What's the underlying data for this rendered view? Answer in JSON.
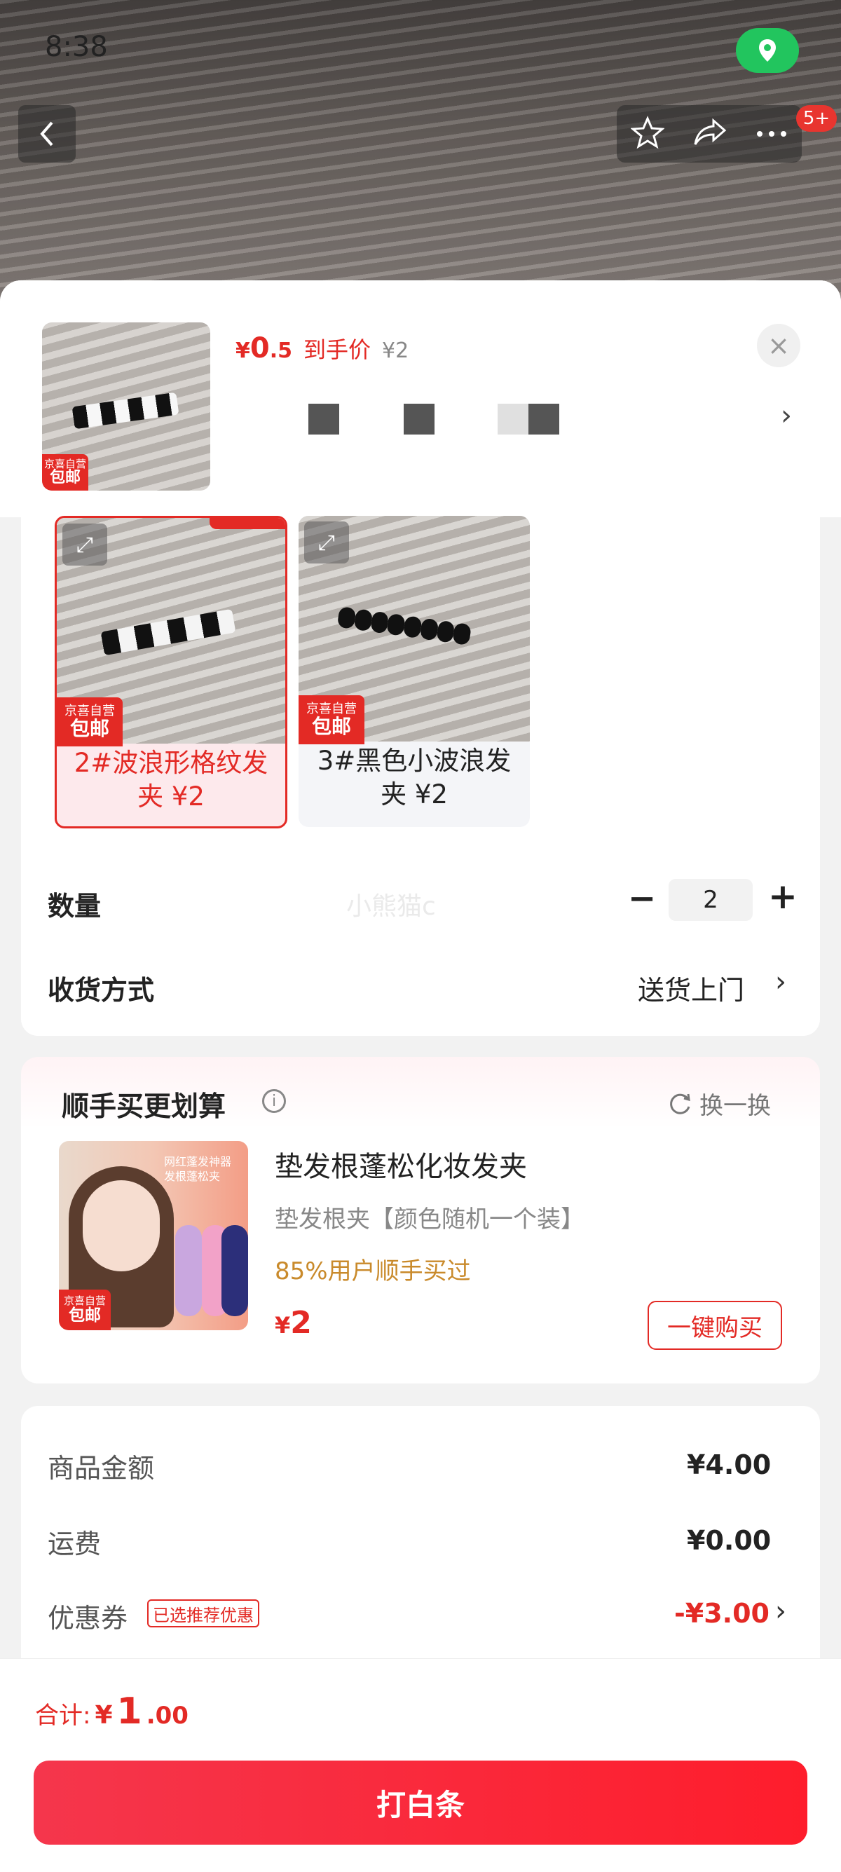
{
  "status": {
    "time": "8:38"
  },
  "header": {
    "cart_badge": "5+"
  },
  "product": {
    "price_int": "0",
    "price_dec": ".5",
    "price_currency": "¥",
    "price_label": "到手价",
    "orig_price": "¥2",
    "jd_tag_top": "京喜自营",
    "jd_tag_bottom": "包邮"
  },
  "variants": [
    {
      "caption_line1": "2#波浪形格纹发",
      "caption_line2": "夹 ¥2",
      "selected": true
    },
    {
      "caption_line1": "3#黑色小波浪发",
      "caption_line2": "夹 ¥2",
      "selected": false
    }
  ],
  "quantity": {
    "label": "数量",
    "value": "2",
    "watermark": "小熊猫c"
  },
  "delivery": {
    "label": "收货方式",
    "value": "送货上门"
  },
  "recommend": {
    "title": "顺手买更划算",
    "swap": "换一换",
    "name": "垫发根蓬松化妆发夹",
    "sub": "垫发根夹【颜色随机一个装】",
    "stat": "85%用户顺手买过",
    "price_currency": "¥",
    "price": "2",
    "buy_label": "一键购买",
    "img_caption": "网红蓬发神器 发根蓬松夹"
  },
  "summary": {
    "goods_label": "商品金额",
    "goods_value": "¥4.00",
    "freight_label": "运费",
    "freight_value": "¥0.00",
    "coupon_label": "优惠券",
    "coupon_tag": "已选推荐优惠",
    "coupon_value": "-¥3.00"
  },
  "footer": {
    "total_label": "合计:",
    "total_currency": "¥",
    "total_int": "1",
    "total_dec": ".00",
    "pay_label": "打白条"
  },
  "colors": {
    "brand_red": "#e32a25",
    "location_green": "#22c55e",
    "stat_orange": "#c98a2b"
  }
}
